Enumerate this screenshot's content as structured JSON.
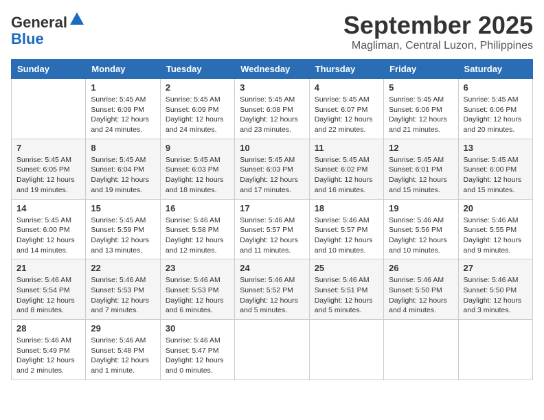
{
  "header": {
    "logo_general": "General",
    "logo_blue": "Blue",
    "month": "September 2025",
    "location": "Magliman, Central Luzon, Philippines"
  },
  "days_of_week": [
    "Sunday",
    "Monday",
    "Tuesday",
    "Wednesday",
    "Thursday",
    "Friday",
    "Saturday"
  ],
  "weeks": [
    [
      {
        "day": "",
        "info": ""
      },
      {
        "day": "1",
        "info": "Sunrise: 5:45 AM\nSunset: 6:09 PM\nDaylight: 12 hours\nand 24 minutes."
      },
      {
        "day": "2",
        "info": "Sunrise: 5:45 AM\nSunset: 6:09 PM\nDaylight: 12 hours\nand 24 minutes."
      },
      {
        "day": "3",
        "info": "Sunrise: 5:45 AM\nSunset: 6:08 PM\nDaylight: 12 hours\nand 23 minutes."
      },
      {
        "day": "4",
        "info": "Sunrise: 5:45 AM\nSunset: 6:07 PM\nDaylight: 12 hours\nand 22 minutes."
      },
      {
        "day": "5",
        "info": "Sunrise: 5:45 AM\nSunset: 6:06 PM\nDaylight: 12 hours\nand 21 minutes."
      },
      {
        "day": "6",
        "info": "Sunrise: 5:45 AM\nSunset: 6:06 PM\nDaylight: 12 hours\nand 20 minutes."
      }
    ],
    [
      {
        "day": "7",
        "info": "Sunrise: 5:45 AM\nSunset: 6:05 PM\nDaylight: 12 hours\nand 19 minutes."
      },
      {
        "day": "8",
        "info": "Sunrise: 5:45 AM\nSunset: 6:04 PM\nDaylight: 12 hours\nand 19 minutes."
      },
      {
        "day": "9",
        "info": "Sunrise: 5:45 AM\nSunset: 6:03 PM\nDaylight: 12 hours\nand 18 minutes."
      },
      {
        "day": "10",
        "info": "Sunrise: 5:45 AM\nSunset: 6:03 PM\nDaylight: 12 hours\nand 17 minutes."
      },
      {
        "day": "11",
        "info": "Sunrise: 5:45 AM\nSunset: 6:02 PM\nDaylight: 12 hours\nand 16 minutes."
      },
      {
        "day": "12",
        "info": "Sunrise: 5:45 AM\nSunset: 6:01 PM\nDaylight: 12 hours\nand 15 minutes."
      },
      {
        "day": "13",
        "info": "Sunrise: 5:45 AM\nSunset: 6:00 PM\nDaylight: 12 hours\nand 15 minutes."
      }
    ],
    [
      {
        "day": "14",
        "info": "Sunrise: 5:45 AM\nSunset: 6:00 PM\nDaylight: 12 hours\nand 14 minutes."
      },
      {
        "day": "15",
        "info": "Sunrise: 5:45 AM\nSunset: 5:59 PM\nDaylight: 12 hours\nand 13 minutes."
      },
      {
        "day": "16",
        "info": "Sunrise: 5:46 AM\nSunset: 5:58 PM\nDaylight: 12 hours\nand 12 minutes."
      },
      {
        "day": "17",
        "info": "Sunrise: 5:46 AM\nSunset: 5:57 PM\nDaylight: 12 hours\nand 11 minutes."
      },
      {
        "day": "18",
        "info": "Sunrise: 5:46 AM\nSunset: 5:57 PM\nDaylight: 12 hours\nand 10 minutes."
      },
      {
        "day": "19",
        "info": "Sunrise: 5:46 AM\nSunset: 5:56 PM\nDaylight: 12 hours\nand 10 minutes."
      },
      {
        "day": "20",
        "info": "Sunrise: 5:46 AM\nSunset: 5:55 PM\nDaylight: 12 hours\nand 9 minutes."
      }
    ],
    [
      {
        "day": "21",
        "info": "Sunrise: 5:46 AM\nSunset: 5:54 PM\nDaylight: 12 hours\nand 8 minutes."
      },
      {
        "day": "22",
        "info": "Sunrise: 5:46 AM\nSunset: 5:53 PM\nDaylight: 12 hours\nand 7 minutes."
      },
      {
        "day": "23",
        "info": "Sunrise: 5:46 AM\nSunset: 5:53 PM\nDaylight: 12 hours\nand 6 minutes."
      },
      {
        "day": "24",
        "info": "Sunrise: 5:46 AM\nSunset: 5:52 PM\nDaylight: 12 hours\nand 5 minutes."
      },
      {
        "day": "25",
        "info": "Sunrise: 5:46 AM\nSunset: 5:51 PM\nDaylight: 12 hours\nand 5 minutes."
      },
      {
        "day": "26",
        "info": "Sunrise: 5:46 AM\nSunset: 5:50 PM\nDaylight: 12 hours\nand 4 minutes."
      },
      {
        "day": "27",
        "info": "Sunrise: 5:46 AM\nSunset: 5:50 PM\nDaylight: 12 hours\nand 3 minutes."
      }
    ],
    [
      {
        "day": "28",
        "info": "Sunrise: 5:46 AM\nSunset: 5:49 PM\nDaylight: 12 hours\nand 2 minutes."
      },
      {
        "day": "29",
        "info": "Sunrise: 5:46 AM\nSunset: 5:48 PM\nDaylight: 12 hours\nand 1 minute."
      },
      {
        "day": "30",
        "info": "Sunrise: 5:46 AM\nSunset: 5:47 PM\nDaylight: 12 hours\nand 0 minutes."
      },
      {
        "day": "",
        "info": ""
      },
      {
        "day": "",
        "info": ""
      },
      {
        "day": "",
        "info": ""
      },
      {
        "day": "",
        "info": ""
      }
    ]
  ]
}
